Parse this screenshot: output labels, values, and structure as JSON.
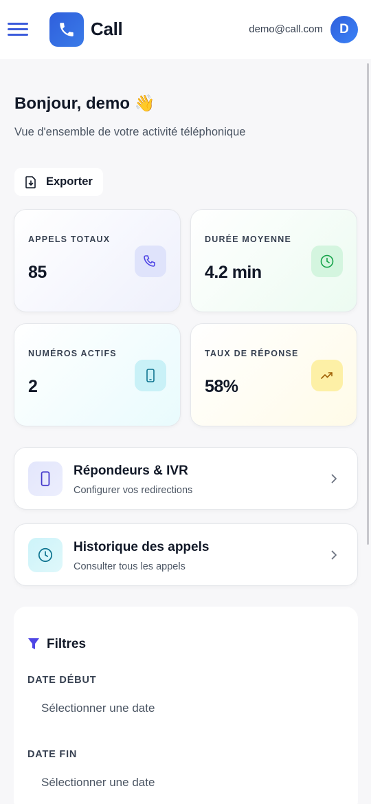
{
  "header": {
    "app_name": "Call",
    "user_email": "demo@call.com",
    "avatar_initial": "D",
    "brand_color": "#2f5fdc"
  },
  "page": {
    "greeting": "Bonjour, demo 👋",
    "subtitle": "Vue d'ensemble de votre activité téléphonique",
    "export_label": "Exporter"
  },
  "stats": [
    {
      "label": "APPELS TOTAUX",
      "value": "85",
      "icon": "phone-icon",
      "color": "#4f46e5"
    },
    {
      "label": "DURÉE MOYENNE",
      "value": "4.2 min",
      "icon": "clock-icon",
      "color": "#16a34a"
    },
    {
      "label": "NUMÉROS ACTIFS",
      "value": "2",
      "icon": "mobile-icon",
      "color": "#0e7490"
    },
    {
      "label": "TAUX DE RÉPONSE",
      "value": "58%",
      "icon": "trending-up-icon",
      "color": "#a16207"
    }
  ],
  "nav_cards": [
    {
      "title": "Répondeurs & IVR",
      "subtitle": "Configurer vos redirections",
      "icon": "mobile-icon"
    },
    {
      "title": "Historique des appels",
      "subtitle": "Consulter tous les appels",
      "icon": "clock-icon"
    }
  ],
  "filters": {
    "title": "Filtres",
    "start_label": "DATE DÉBUT",
    "start_placeholder": "Sélectionner une date",
    "end_label": "DATE FIN",
    "end_placeholder": "Sélectionner une date"
  }
}
